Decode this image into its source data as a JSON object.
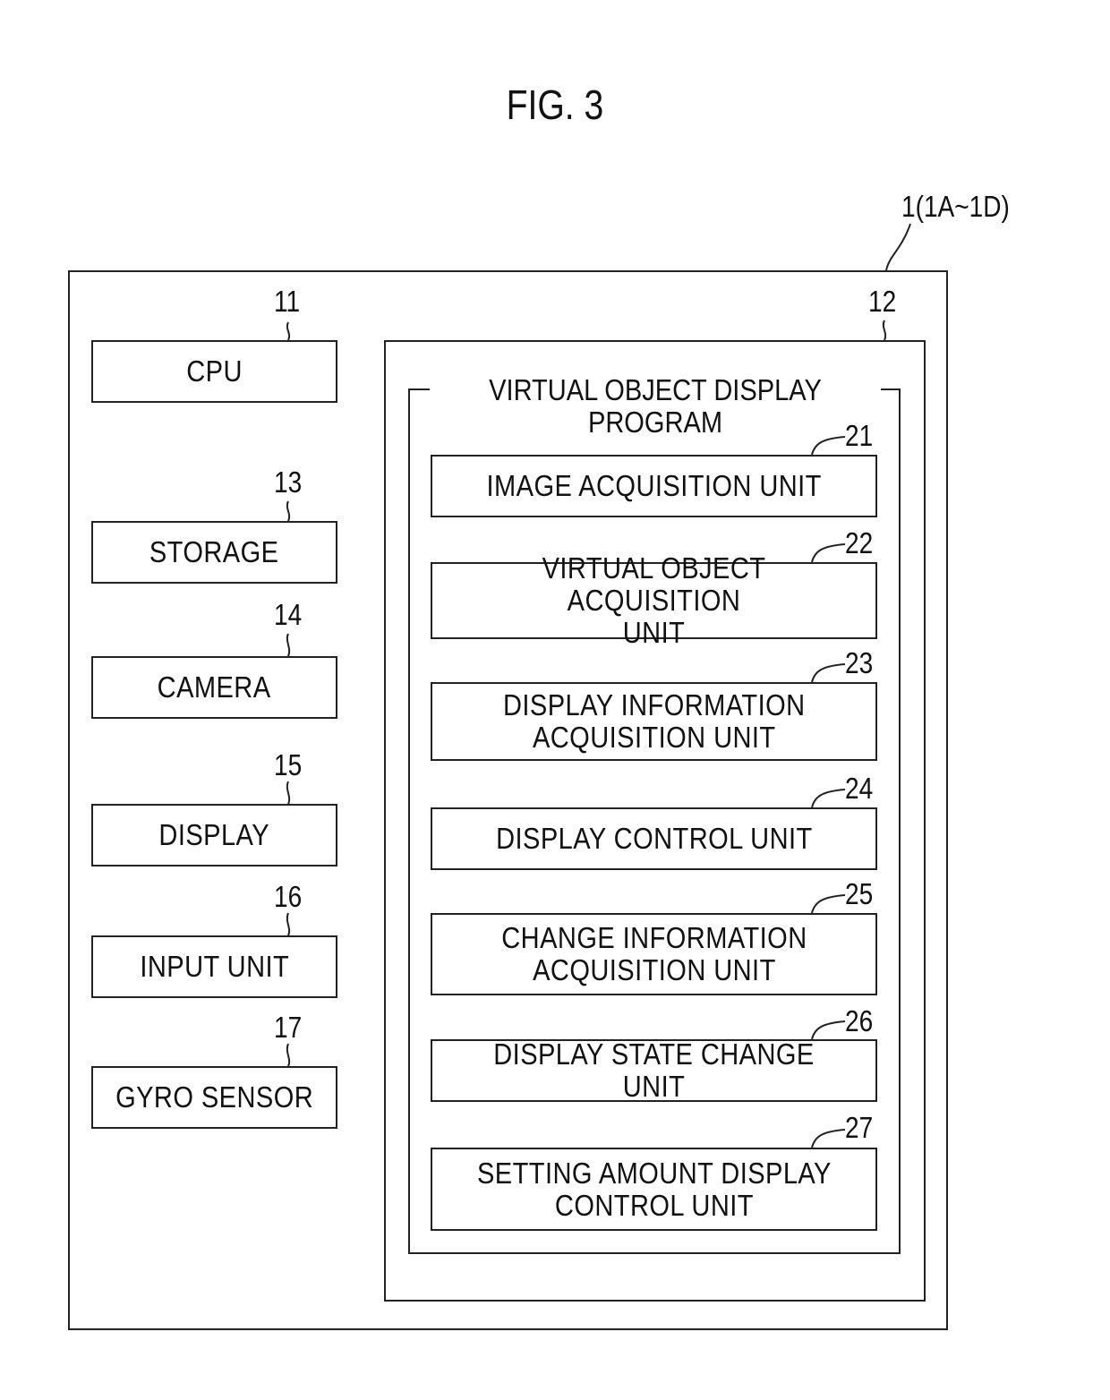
{
  "figure": {
    "title": "FIG. 3",
    "device_label": "1(1A~1D)"
  },
  "hardware": [
    {
      "ref": "11",
      "label": "CPU"
    },
    {
      "ref": "13",
      "label": "STORAGE"
    },
    {
      "ref": "14",
      "label": "CAMERA"
    },
    {
      "ref": "15",
      "label": "DISPLAY"
    },
    {
      "ref": "16",
      "label": "INPUT UNIT"
    },
    {
      "ref": "17",
      "label": "GYRO SENSOR"
    }
  ],
  "memory": {
    "ref": "12",
    "program_title_line1": "VIRTUAL OBJECT DISPLAY",
    "program_title_line2": "PROGRAM",
    "units": [
      {
        "ref": "21",
        "label": "IMAGE ACQUISITION UNIT"
      },
      {
        "ref": "22",
        "label": "VIRTUAL OBJECT ACQUISITION\nUNIT"
      },
      {
        "ref": "23",
        "label": "DISPLAY INFORMATION\nACQUISITION UNIT"
      },
      {
        "ref": "24",
        "label": "DISPLAY CONTROL UNIT"
      },
      {
        "ref": "25",
        "label": "CHANGE INFORMATION\nACQUISITION UNIT"
      },
      {
        "ref": "26",
        "label": "DISPLAY STATE CHANGE UNIT"
      },
      {
        "ref": "27",
        "label": "SETTING AMOUNT DISPLAY\nCONTROL UNIT"
      }
    ]
  }
}
